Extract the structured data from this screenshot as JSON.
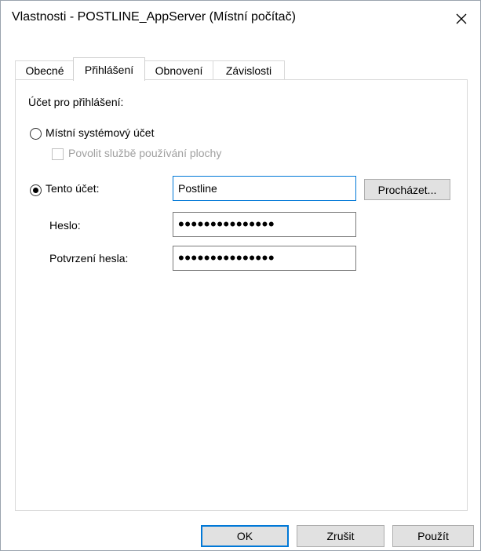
{
  "window": {
    "title": "Vlastnosti - POSTLINE_AppServer (Místní počítač)"
  },
  "tabs": [
    {
      "label": "Obecné",
      "active": false
    },
    {
      "label": "Přihlášení",
      "active": true
    },
    {
      "label": "Obnovení",
      "active": false
    },
    {
      "label": "Závislosti",
      "active": false
    }
  ],
  "login": {
    "account_label": "Účet pro přihlášení:",
    "local_system": {
      "label": "Místní systémový účet",
      "selected": false
    },
    "allow_desktop": {
      "label": "Povolit službě používání plochy",
      "checked": false,
      "enabled": false
    },
    "this_account": {
      "label": "Tento účet:",
      "selected": true,
      "value": "Postline"
    },
    "browse_label": "Procházet...",
    "password": {
      "label": "Heslo:",
      "value": "•••••••••••••••"
    },
    "confirm_password": {
      "label": "Potvrzení hesla:",
      "value": "•••••••••••••••"
    }
  },
  "buttons": {
    "ok": "OK",
    "cancel": "Zrušit",
    "apply": "Použít"
  },
  "colors": {
    "accent": "#0078d7",
    "button_bg": "#e1e1e1",
    "disabled_text": "#a0a0a0"
  },
  "icons": {
    "close": "close-icon"
  }
}
